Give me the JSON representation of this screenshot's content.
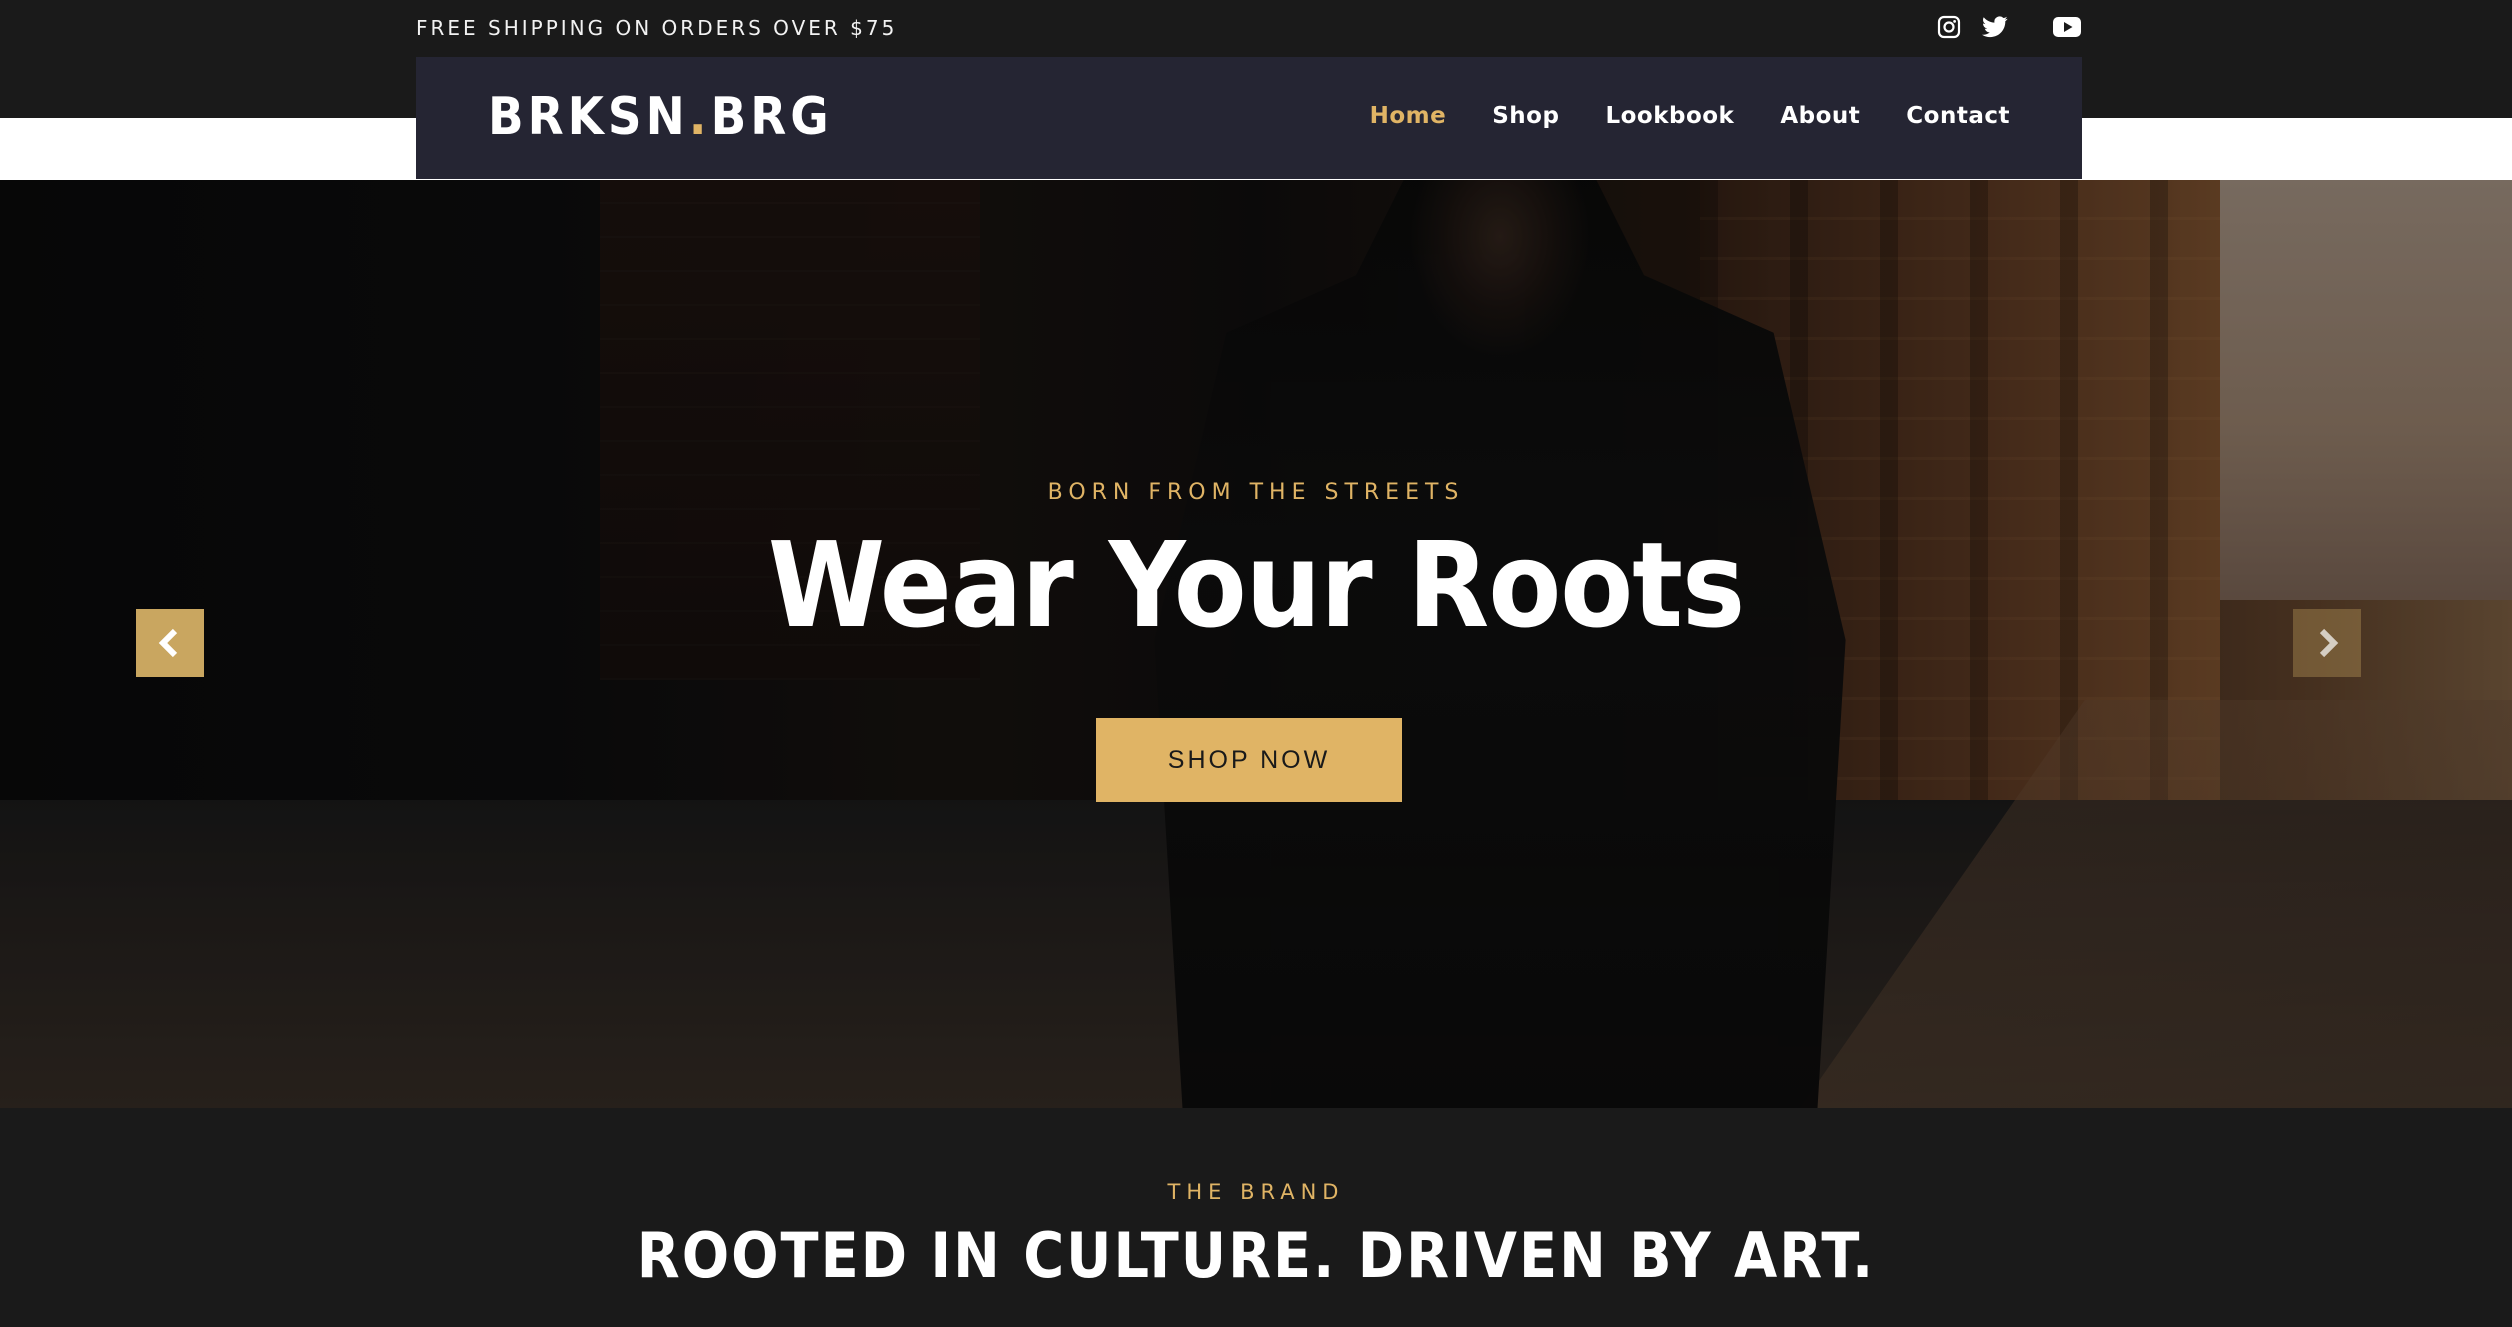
{
  "topbar": {
    "promo_text": "FREE SHIPPING ON ORDERS OVER $75",
    "socials": [
      {
        "icon": "instagram-icon"
      },
      {
        "icon": "twitter-icon"
      },
      {
        "icon": "youtube-icon"
      }
    ]
  },
  "nav": {
    "logo_main": "BRKSN",
    "logo_dot": ".",
    "logo_end": "BRG",
    "links": [
      "Home",
      "Shop",
      "Lookbook",
      "About",
      "Contact"
    ],
    "active_link": "Home"
  },
  "hero": {
    "eyebrow": "BORN FROM THE STREETS",
    "headline": "Wear Your Roots",
    "cta_label": "SHOP NOW",
    "prev_icon": "chevron-left-icon",
    "next_icon": "chevron-right-icon"
  },
  "brand": {
    "eyebrow": "THE BRAND",
    "title": "ROOTED IN CULTURE. DRIVEN BY ART."
  },
  "colors": {
    "accent": "#e0b465",
    "nav_bg": "#252533",
    "page_bg": "#1a1a1a",
    "text": "#ffffff"
  }
}
